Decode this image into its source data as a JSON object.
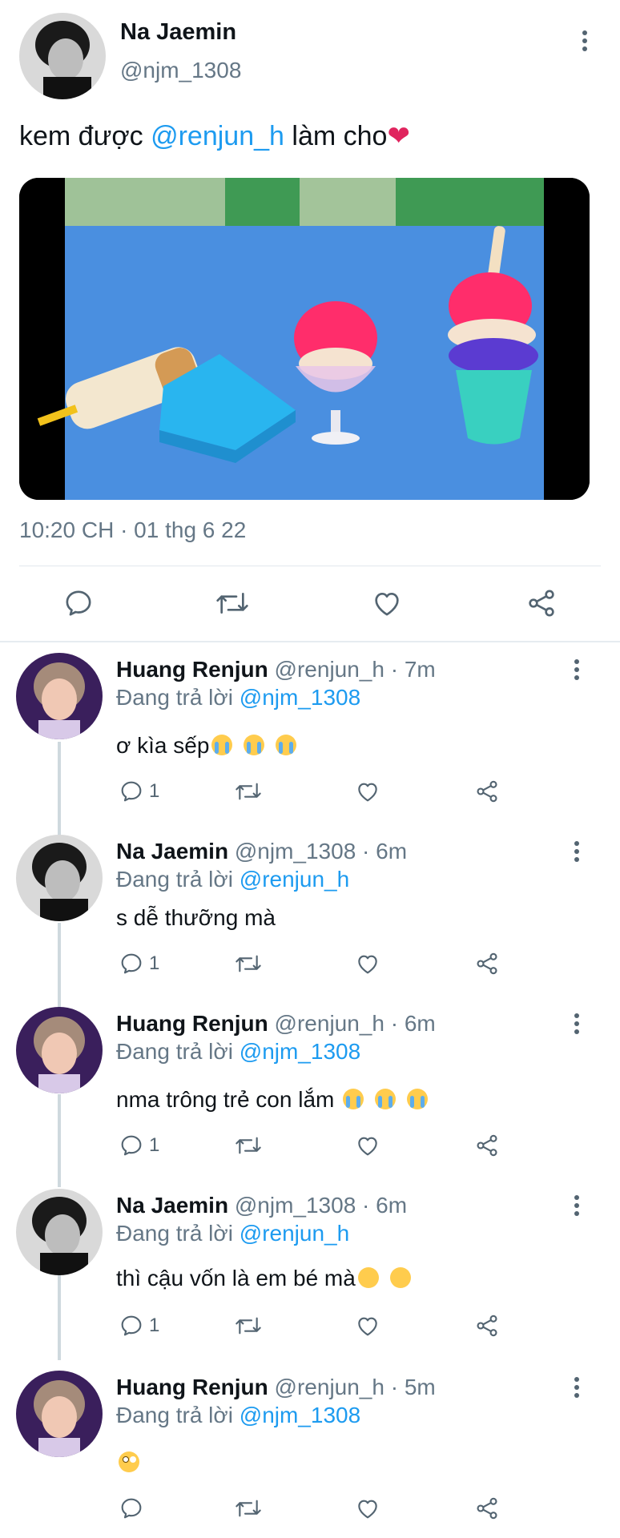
{
  "main_tweet": {
    "author_name": "Na Jaemin",
    "author_handle": "@njm_1308",
    "text_before": "kem được ",
    "mention": "@renjun_h",
    "text_after": " làm cho",
    "heart": "❤",
    "timestamp": "10:20 CH · 01 thg 6 22"
  },
  "replies": [
    {
      "name": "Huang Renjun",
      "handle_time": "@renjun_h · 7m",
      "replying_label": "Đang trả lời ",
      "replying_to": "@njm_1308",
      "text": "ơ kìa sếp",
      "emoji": "cry",
      "emoji_count": 3,
      "reply_count": "1"
    },
    {
      "name": "Na Jaemin",
      "handle_time": "@njm_1308 · 6m",
      "replying_label": "Đang trả lời ",
      "replying_to": "@renjun_h",
      "text": "s dễ thưỡng mà",
      "emoji": "",
      "emoji_count": 0,
      "reply_count": "1"
    },
    {
      "name": "Huang Renjun",
      "handle_time": "@renjun_h · 6m",
      "replying_label": "Đang trả lời ",
      "replying_to": "@njm_1308",
      "text": "nma trông trẻ con lắm ",
      "emoji": "cry",
      "emoji_count": 3,
      "reply_count": "1"
    },
    {
      "name": "Na Jaemin",
      "handle_time": "@njm_1308 · 6m",
      "replying_label": "Đang trả lời ",
      "replying_to": "@renjun_h",
      "text": "thì cậu vốn là em bé mà",
      "emoji": "joy",
      "emoji_count": 2,
      "reply_count": "1"
    },
    {
      "name": "Huang Renjun",
      "handle_time": "@renjun_h · 5m",
      "replying_label": "Đang trả lời ",
      "replying_to": "@njm_1308",
      "text": "",
      "emoji": "flush",
      "emoji_count": 1,
      "reply_count": ""
    }
  ],
  "colors": {
    "accent": "#1d9bf0",
    "secondary_text": "#657786",
    "heart": "#e0245e"
  }
}
